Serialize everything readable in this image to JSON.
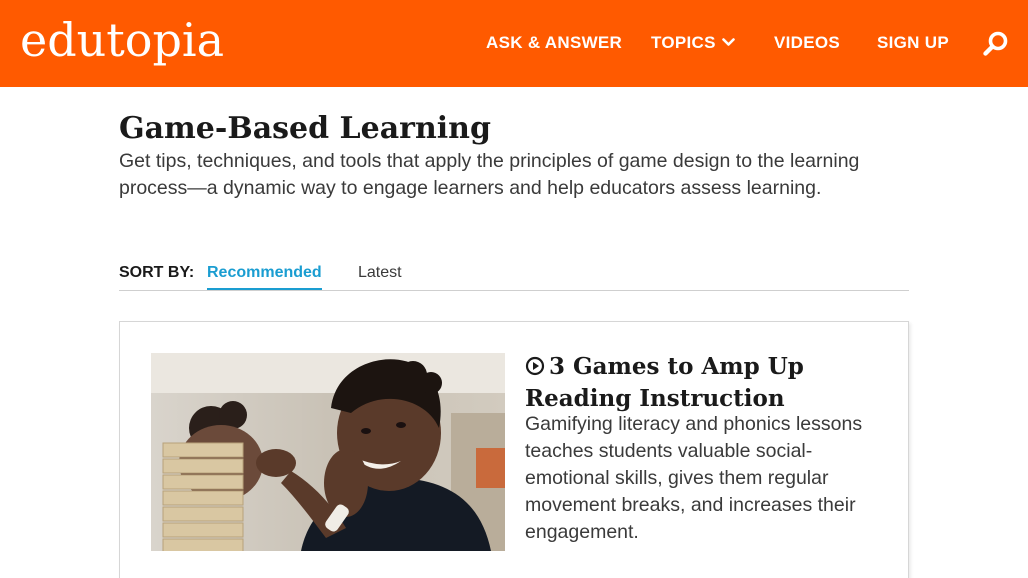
{
  "header": {
    "logo": "edutopia",
    "nav": {
      "ask": "ASK & ANSWER",
      "topics": "TOPICS",
      "videos": "VIDEOS",
      "signup": "SIGN UP"
    },
    "icons": {
      "topics_dropdown": "chevron-down-icon",
      "search": "search-icon"
    },
    "color": "#ff5a00"
  },
  "page": {
    "title": "Game-Based Learning",
    "description": "Get tips, techniques, and tools that apply the principles of game design to the learning process—a dynamic way to engage learners and help educators assess learning."
  },
  "sort": {
    "label": "SORT BY:",
    "options": [
      "Recommended",
      "Latest"
    ],
    "active": "Recommended",
    "active_color": "#1a9dd1"
  },
  "article": {
    "title": "3 Games to Amp Up Reading Instruction",
    "icon": "play-circle-icon",
    "description": "Gamifying literacy and phonics lessons teaches students valuable social-emotional skills, gives them regular movement breaks, and increases their engagement."
  }
}
